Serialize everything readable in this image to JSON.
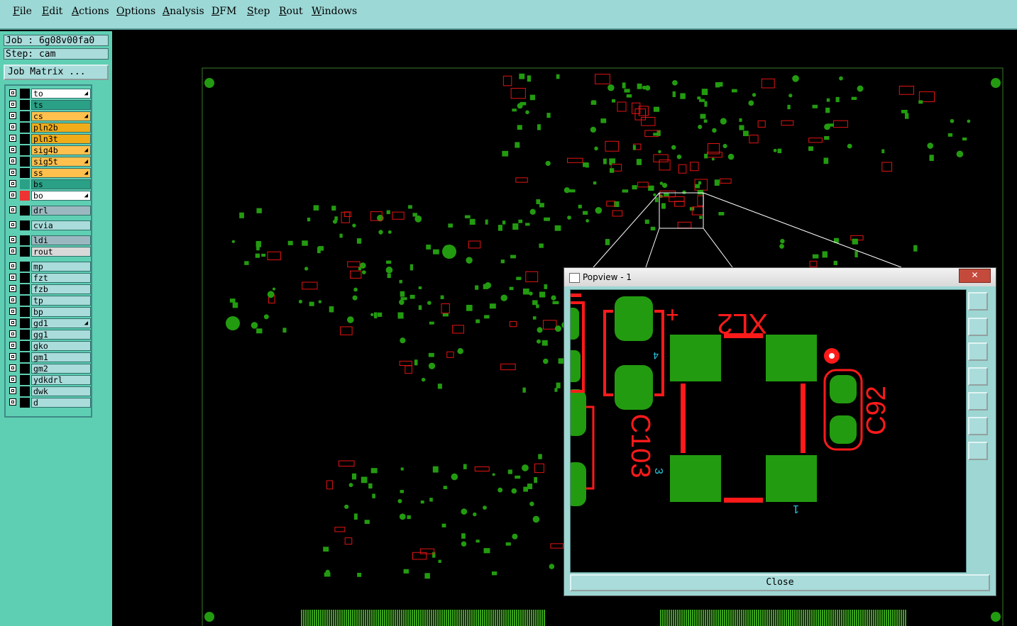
{
  "menu": [
    "File",
    "Edit",
    "Actions",
    "Options",
    "Analysis",
    "DFM",
    "Step",
    "Rout",
    "Windows"
  ],
  "job": {
    "job_text": "Job : 6g08v00fa0",
    "step_text": "Step: cam",
    "matrix_label": "Job Matrix ..."
  },
  "layers": [
    {
      "name": "to",
      "color": "#ffffff",
      "edit": true
    },
    {
      "name": "ts",
      "color": "#2aa186",
      "edit": false
    },
    {
      "name": "cs",
      "color": "#ffc04d",
      "edit": true
    },
    {
      "name": "pln2b",
      "color": "#f0ac19",
      "edit": false
    },
    {
      "name": "pln3t",
      "color": "#f0ac19",
      "edit": false
    },
    {
      "name": "sig4b",
      "color": "#ffc04d",
      "edit": true
    },
    {
      "name": "sig5t",
      "color": "#ffc04d",
      "edit": true
    },
    {
      "name": "ss",
      "color": "#ffc04d",
      "edit": true
    },
    {
      "name": "bs",
      "color": "#2aa186",
      "edit": false
    },
    {
      "name": "bo",
      "color": "#ffffff",
      "edit": true
    },
    {
      "name": "drl",
      "color": "#9bb8c0",
      "edit": false
    },
    {
      "name": "cvia",
      "color": "#a9dcdb",
      "edit": false
    },
    {
      "name": "ldi",
      "color": "#9bb8c0",
      "edit": false
    },
    {
      "name": "rout",
      "color": "#d9d9d9",
      "edit": false
    },
    {
      "name": "mp",
      "color": "#a9dcdb",
      "edit": false
    },
    {
      "name": "fzt",
      "color": "#a9dcdb",
      "edit": false
    },
    {
      "name": "fzb",
      "color": "#a9dcdb",
      "edit": false
    },
    {
      "name": "tp",
      "color": "#a9dcdb",
      "edit": false
    },
    {
      "name": "bp",
      "color": "#a9dcdb",
      "edit": false
    },
    {
      "name": "gd1",
      "color": "#a9dcdb",
      "edit": true
    },
    {
      "name": "gg1",
      "color": "#a9dcdb",
      "edit": false
    },
    {
      "name": "gko",
      "color": "#a9dcdb",
      "edit": false
    },
    {
      "name": "gm1",
      "color": "#a9dcdb",
      "edit": false
    },
    {
      "name": "gm2",
      "color": "#a9dcdb",
      "edit": false
    },
    {
      "name": "ydkdrl",
      "color": "#a9dcdb",
      "edit": false
    },
    {
      "name": "dwk",
      "color": "#a9dcdb",
      "edit": false
    },
    {
      "name": "d",
      "color": "#a9dcdb",
      "edit": false
    }
  ],
  "popview": {
    "title": "Popview - 1",
    "close_x": "✕",
    "close_label": "Close",
    "labels": {
      "c103": "C103",
      "c92": "C92",
      "xl2": "XL2",
      "pin3": "3",
      "pin4": "4",
      "pin1": "1",
      "plus": "+"
    }
  },
  "colors": {
    "copper": "#228b22",
    "silk": "#ff1a1a",
    "pad_green": "#239b10"
  }
}
